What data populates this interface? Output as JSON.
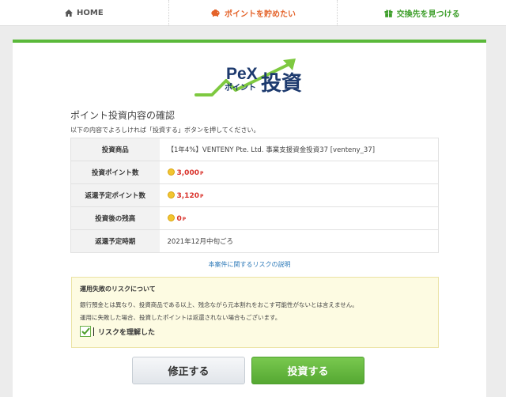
{
  "nav": {
    "home": "HOME",
    "save_points": "ポイントを貯めたい",
    "find_exchange": "交換先を見つける"
  },
  "logo": {
    "brand": "PeX",
    "sub": "ポイント",
    "title": "投資"
  },
  "confirm": {
    "title": "ポイント投資内容の確認",
    "instruction": "以下の内容でよろしければ「投資する」ボタンを押してください。"
  },
  "table": {
    "product_label": "投資商品",
    "product_value": "【1年4%】VENTENY Pte. Ltd. 事業支援資金投資37 [venteny_37]",
    "invest_points_label": "投資ポイント数",
    "invest_points_value": "3,000",
    "return_points_label": "返還予定ポイント数",
    "return_points_value": "3,120",
    "balance_label": "投資後の残高",
    "balance_value": "0",
    "return_date_label": "返還予定時期",
    "return_date_value": "2021年12月中旬ごろ",
    "point_unit": "P"
  },
  "risk_link": "本案件に関するリスクの説明",
  "risk": {
    "title": "運用失敗のリスクについて",
    "text1": "銀行預金とは異なり、投資商品である以上、残念ながら元本割れをおこす可能性がないとは言えません。",
    "text2": "運用に失敗した場合、投資したポイントは返還されない場合もございます。",
    "checkbox_label": "リスクを理解した",
    "checked": true
  },
  "buttons": {
    "fix": "修正する",
    "invest": "投資する"
  },
  "colors": {
    "accent_green": "#5ab93a",
    "point_red": "#d9312a",
    "link_blue": "#2c79b8",
    "nav_orange": "#e4632a"
  }
}
